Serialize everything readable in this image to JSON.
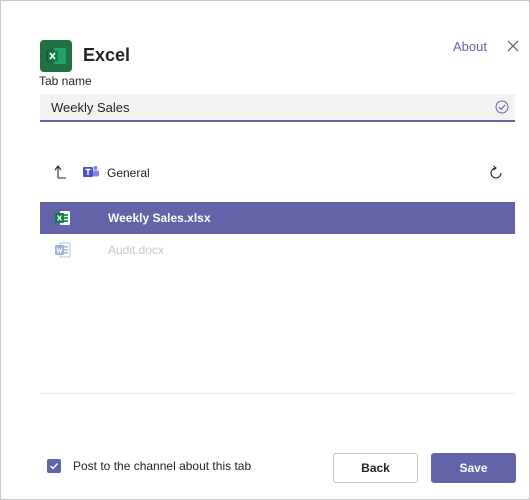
{
  "header": {
    "app_name": "Excel",
    "about_label": "About",
    "app_icon": "excel-icon",
    "close_icon": "close-icon"
  },
  "tab_name": {
    "label": "Tab name",
    "value": "Weekly Sales",
    "valid_icon": "checkmark-circle-icon"
  },
  "location": {
    "label": "General",
    "up_icon": "arrow-up-icon",
    "team_icon": "teams-icon",
    "refresh_icon": "refresh-icon"
  },
  "files": [
    {
      "name": "Weekly Sales.xlsx",
      "icon": "excel-file-icon",
      "state": "selected"
    },
    {
      "name": "Audit.docx",
      "icon": "word-file-icon",
      "state": "disabled"
    }
  ],
  "footer": {
    "post_label": "Post to the channel about this tab",
    "post_checked": true,
    "back_label": "Back",
    "save_label": "Save"
  },
  "colors": {
    "accent": "#6264a7",
    "excel": "#1f7244",
    "word": "#2b579a",
    "field_bg": "#f3f2f1"
  }
}
